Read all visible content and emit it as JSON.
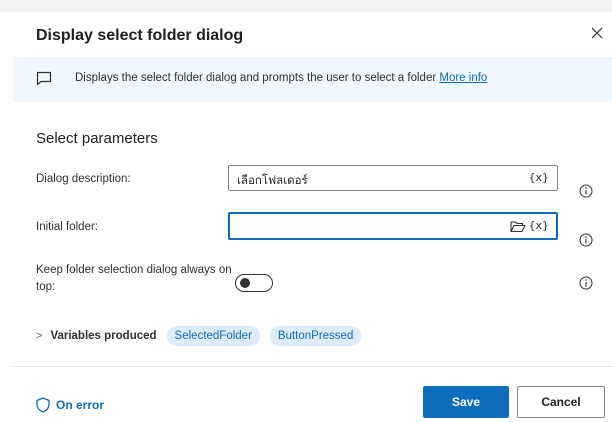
{
  "dialog": {
    "title": "Display select folder dialog",
    "info_text": "Displays the select folder dialog and prompts the user to select a folder",
    "info_link": "More info"
  },
  "section_title": "Select parameters",
  "fields": {
    "dialog_description": {
      "label": "Dialog description:",
      "value": "เลือกโฟลเดอร์",
      "var_button": "{x}"
    },
    "initial_folder": {
      "label": "Initial folder:",
      "value": "",
      "var_button": "{x}"
    },
    "keep_on_top": {
      "label": "Keep folder selection dialog always on top:",
      "checked": false
    }
  },
  "variables": {
    "label": "Variables produced",
    "items": [
      "SelectedFolder",
      "ButtonPressed"
    ]
  },
  "footer": {
    "on_error": "On error",
    "save": "Save",
    "cancel": "Cancel"
  },
  "colors": {
    "accent": "#0f6cbd",
    "infobar_bg": "#eff6fc",
    "chip_bg": "#deecf9"
  },
  "icons": [
    "close-icon",
    "chat-icon",
    "info-icon",
    "folder-icon",
    "shield-icon",
    "chevron-right-icon"
  ]
}
